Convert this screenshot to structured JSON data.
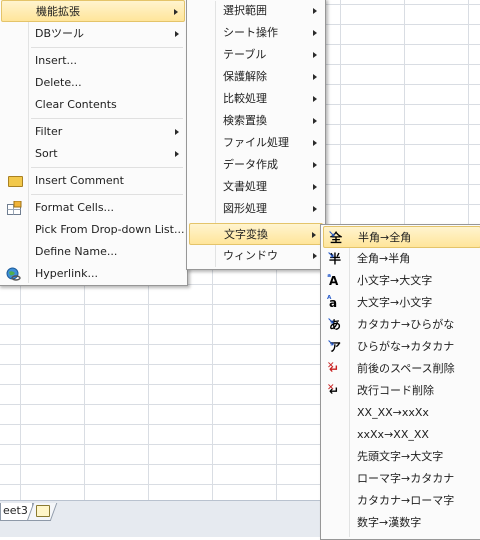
{
  "colors": {
    "highlight_top": "#fff4cf",
    "highlight_bottom": "#ffe59a",
    "menu_bg": "#fbfbfb"
  },
  "sheet": {
    "tab_label": "eet3"
  },
  "context_menu": {
    "items": [
      {
        "label": "機能拡張",
        "submenu": true,
        "highlighted": true
      },
      {
        "label": "DBツール",
        "submenu": true
      },
      {
        "label": "Insert..."
      },
      {
        "label": "Delete..."
      },
      {
        "label": "Clear Contents"
      },
      {
        "label": "Filter",
        "submenu": true
      },
      {
        "label": "Sort",
        "submenu": true
      },
      {
        "label": "Insert Comment",
        "icon": "comment-folder-icon"
      },
      {
        "label": "Format Cells...",
        "icon": "format-cells-icon"
      },
      {
        "label": "Pick From Drop-down List..."
      },
      {
        "label": "Define Name..."
      },
      {
        "label": "Hyperlink...",
        "icon": "hyperlink-globe-icon"
      }
    ]
  },
  "extension_menu": {
    "items": [
      {
        "label": "選択範囲"
      },
      {
        "label": "シート操作"
      },
      {
        "label": "テーブル"
      },
      {
        "label": "保護解除"
      },
      {
        "label": "比較処理"
      },
      {
        "label": "検索置換"
      },
      {
        "label": "ファイル処理"
      },
      {
        "label": "データ作成"
      },
      {
        "label": "文書処理"
      },
      {
        "label": "図形処理"
      },
      {
        "label": "文字変換",
        "highlighted": true
      },
      {
        "label": "ウィンドウ"
      }
    ]
  },
  "conversion_menu": {
    "items": [
      {
        "label": "半角→全角",
        "icon": "zenkaku-icon",
        "glyph": "全",
        "highlighted": true
      },
      {
        "label": "全角→半角",
        "icon": "hankaku-icon",
        "glyph": "半"
      },
      {
        "label": "小文字→大文字",
        "icon": "uppercase-icon",
        "glyph": "A"
      },
      {
        "label": "大文字→小文字",
        "icon": "lowercase-icon",
        "glyph": "a"
      },
      {
        "label": "カタカナ→ひらがな",
        "icon": "hiragana-icon",
        "glyph": "あ"
      },
      {
        "label": "ひらがな→カタカナ",
        "icon": "katakana-icon",
        "glyph": "ア"
      },
      {
        "label": "前後のスペース削除",
        "icon": "trim-space-icon",
        "glyph": "↵"
      },
      {
        "label": "改行コード削除",
        "icon": "remove-linebreak-icon",
        "glyph": "↵"
      },
      {
        "label": "XX_XX→xxXx"
      },
      {
        "label": "xxXx→XX_XX"
      },
      {
        "label": "先頭文字→大文字"
      },
      {
        "label": "ローマ字→カタカナ"
      },
      {
        "label": "カタカナ→ローマ字"
      },
      {
        "label": "数字→漢数字"
      }
    ]
  }
}
